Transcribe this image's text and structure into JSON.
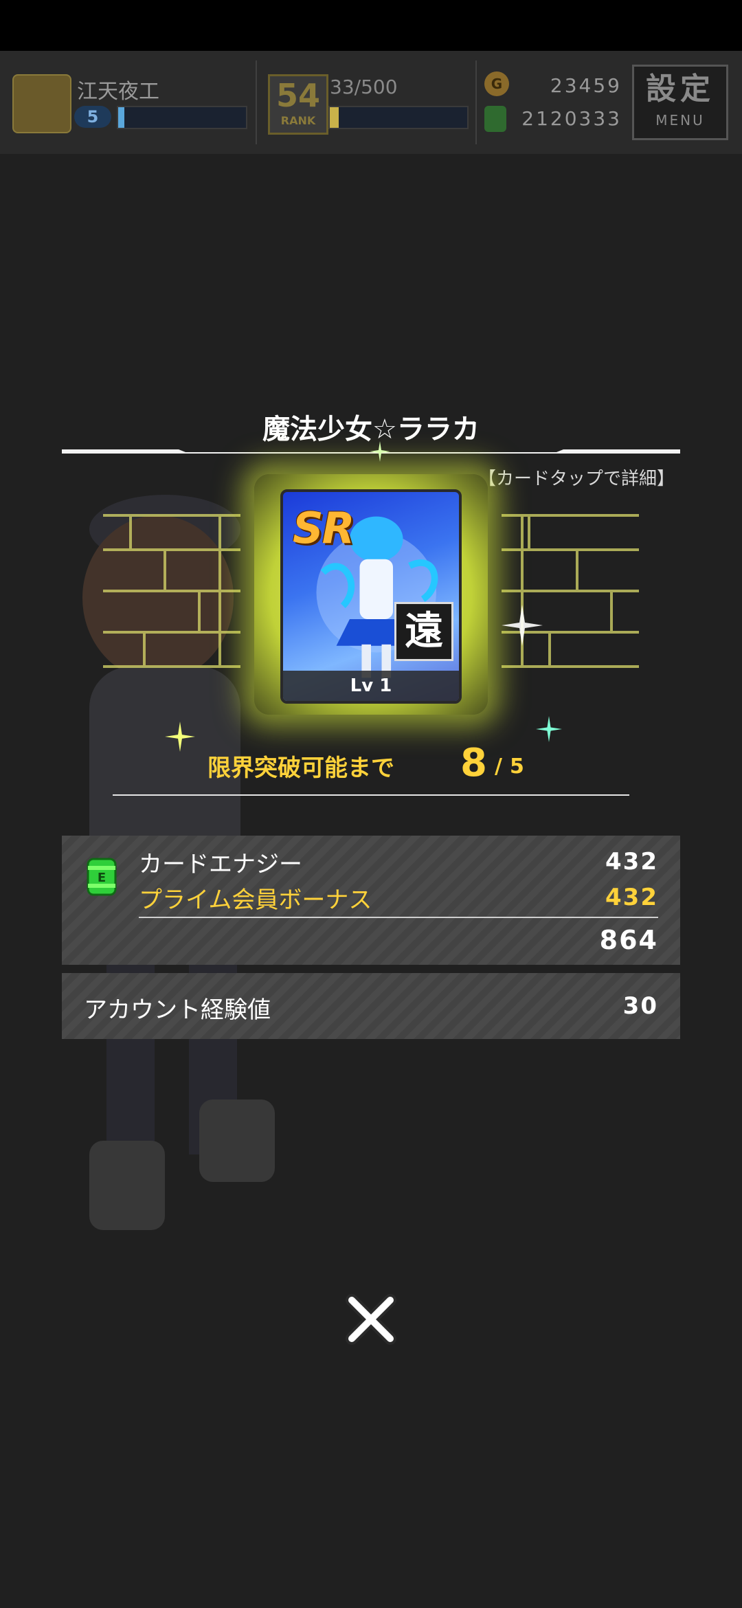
{
  "header": {
    "player_name": "江天夜工",
    "player_level": "5",
    "player_level_progress": 0.05,
    "rank_number": "54",
    "rank_word": "RANK",
    "rank_progress_text": "33/500",
    "rank_progress": 0.066,
    "coins": "23459",
    "energy": "2120333",
    "menu_main": "設定",
    "menu_sub": "MENU"
  },
  "card": {
    "name": "魔法少女☆ララカ",
    "hint": "【カードタップで詳細】",
    "rarity": "SR",
    "range_type": "遠",
    "level": "Lv 1",
    "limit_break_label": "限界突破可能まで",
    "limit_break_current": "8",
    "limit_break_max": "5"
  },
  "rewards": {
    "energy_label": "カードエナジー",
    "energy_value": "432",
    "bonus_label": "プライム会員ボーナス",
    "bonus_value": "432",
    "total_value": "864",
    "exp_label": "アカウント経験値",
    "exp_value": "30"
  },
  "colors": {
    "accent_yellow": "#ffd23a",
    "glow": "#e6f54a",
    "panel": "#4a4a4a"
  },
  "icons": {
    "close": "close-icon",
    "energy": "card-energy-icon",
    "coin": "coin-icon"
  }
}
